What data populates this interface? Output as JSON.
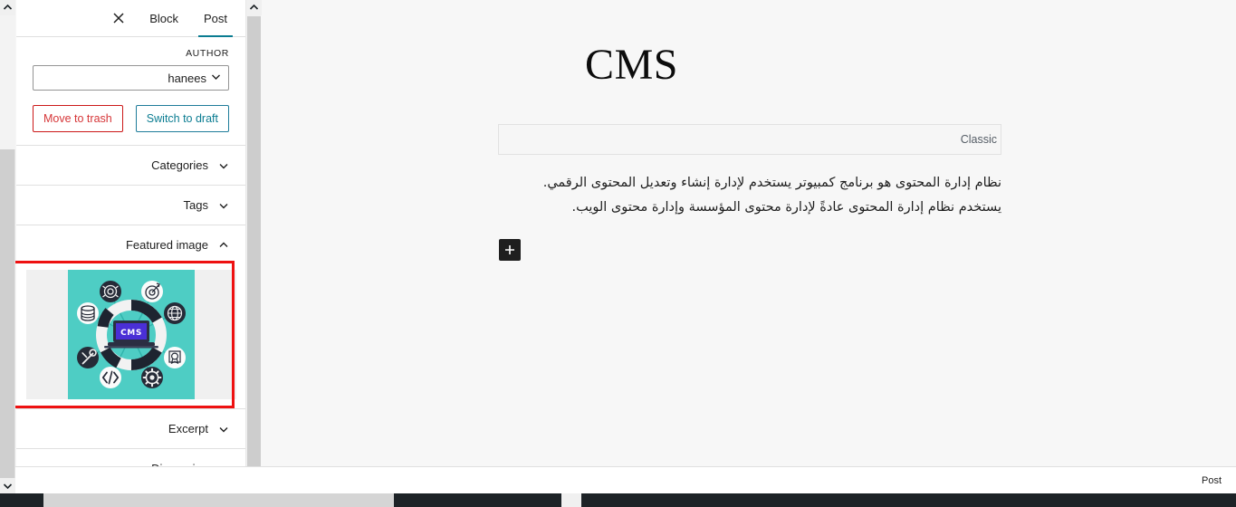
{
  "sidebar": {
    "tabs": [
      {
        "label": "Block",
        "active": false,
        "name": "tab-block"
      },
      {
        "label": "Post",
        "active": true,
        "name": "tab-post"
      }
    ],
    "close_icon": "close-icon",
    "author": {
      "label": "AUTHOR",
      "value": "hanees",
      "chevron_icon": "chevron-down-icon"
    },
    "buttons": {
      "trash_label": "Move to trash",
      "trash_color": "#d63638",
      "draft_label": "Switch to draft",
      "draft_color": "#0a7c91"
    },
    "panels": [
      {
        "title": "Categories",
        "expanded": false,
        "icon": "chevron-down-icon"
      },
      {
        "title": "Tags",
        "expanded": false,
        "icon": "chevron-down-icon"
      },
      {
        "title": "Featured image",
        "expanded": true,
        "icon": "chevron-up-icon"
      },
      {
        "title": "Excerpt",
        "expanded": false,
        "icon": "chevron-down-icon"
      },
      {
        "title": "Discussion",
        "expanded": false,
        "icon": "chevron-down-icon"
      }
    ],
    "featured_image": {
      "alt": "CMS content management system illustration",
      "background_color": "#4ecdc4",
      "laptop_screen_color": "#4a2fd6",
      "screen_text": "CMS",
      "ring_dark_color": "#1e2430",
      "ring_light_color": "#f5f5f5",
      "icons": [
        "fingerprint-icon",
        "target-icon",
        "globe-icon",
        "certificate-icon",
        "gear-icon",
        "code-icon",
        "tools-icon",
        "database-icon"
      ]
    },
    "highlight": {
      "color": "#ee1111",
      "target": "featured-image-panel"
    }
  },
  "editor": {
    "post_title": "CMS",
    "classic_block_label": "Classic",
    "paragraphs": [
      "نظام إدارة المحتوى هو برنامج كمبيوتر يستخدم لإدارة إنشاء وتعديل المحتوى الرقمي.",
      "يستخدم نظام إدارة المحتوى عادةً لإدارة محتوى المؤسسة وإدارة محتوى الويب."
    ],
    "add_block_icon": "plus-icon"
  },
  "bottom_bar": {
    "breadcrumb": "Post"
  },
  "scrollbars": {
    "sidebar_up_icon": "chevron-up-icon",
    "sidebar_down_icon": "chevron-down-icon",
    "outer_up_icon": "chevron-up-icon",
    "outer_down_icon": "chevron-down-icon"
  }
}
